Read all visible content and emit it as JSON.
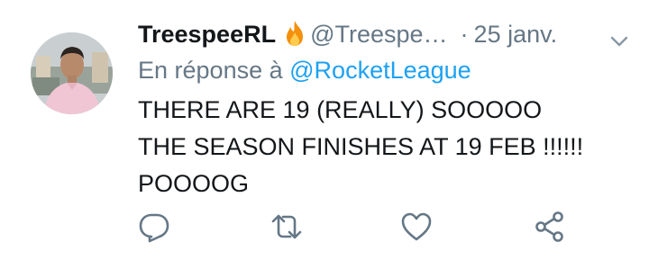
{
  "tweet": {
    "display_name": "TreespeeRL",
    "emoji": "fire-icon",
    "handle": "@Treespe…",
    "separator": "·",
    "date": "25 janv.",
    "reply_prefix": "En réponse à",
    "reply_mention": "@RocketLeague",
    "text_lines": [
      "THERE ARE 19 (REALLY) SOOOOO",
      "THE SEASON FINISHES AT 19 FEB !!!!!!",
      "POOOOG"
    ]
  },
  "actions": [
    "reply-icon",
    "retweet-icon",
    "like-icon",
    "share-icon"
  ],
  "colors": {
    "text": "#14171a",
    "secondary": "#657786",
    "link": "#1da1f2",
    "fire": "#f4900c"
  }
}
